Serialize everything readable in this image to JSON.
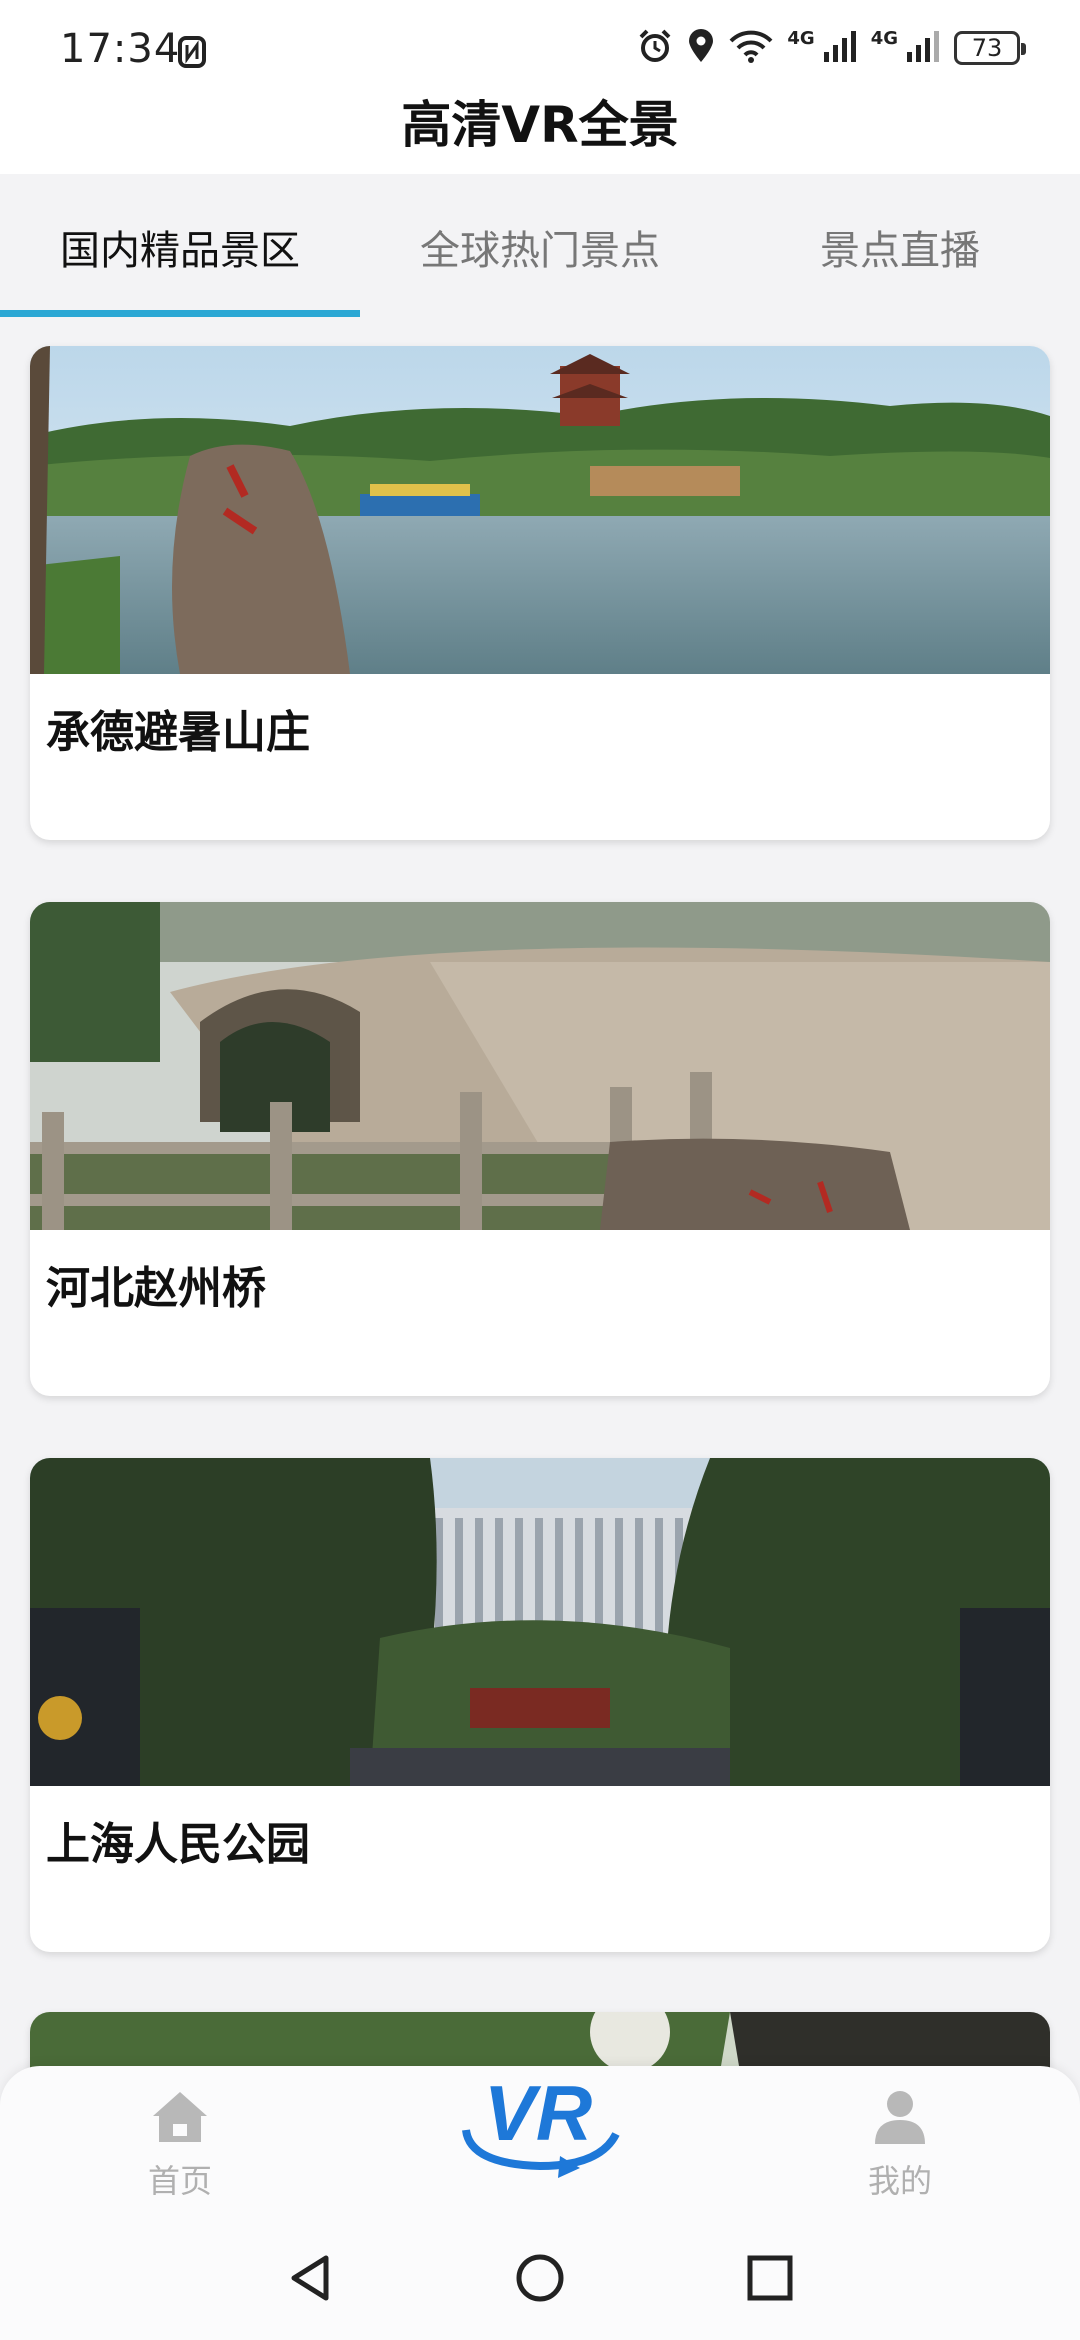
{
  "status_bar": {
    "time": "17:34",
    "net1": "4G",
    "net2": "4G",
    "battery": "73",
    "icons": [
      "nfc-icon",
      "alarm-icon",
      "location-icon",
      "wifi-icon",
      "signal-icon",
      "battery-icon"
    ]
  },
  "header": {
    "title": "高清VR全景"
  },
  "tabs": [
    {
      "label": "国内精品景区",
      "active": true
    },
    {
      "label": "全球热门景点",
      "active": false
    },
    {
      "label": "景点直播",
      "active": false
    }
  ],
  "cards": [
    {
      "title": "承德避暑山庄"
    },
    {
      "title": "河北赵州桥"
    },
    {
      "title": "上海人民公园"
    }
  ],
  "bottom_nav": {
    "home_label": "首页",
    "vr_label": "VR",
    "me_label": "我的"
  },
  "colors": {
    "accent": "#2aa7d4",
    "vr_blue": "#1e78d8",
    "inactive": "#b0b0b0"
  }
}
